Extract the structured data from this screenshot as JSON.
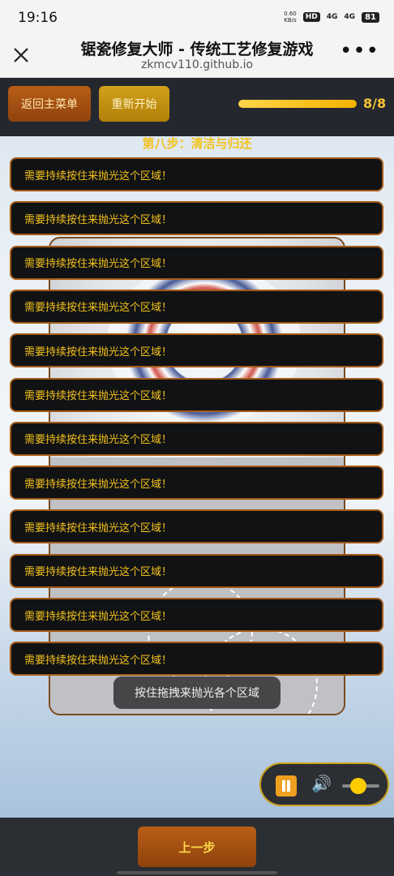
{
  "status_bar": {
    "time": "19:16",
    "speed": "0.60\nKB/s",
    "hd": "HD",
    "signal1": "4G",
    "signal2": "4G",
    "battery": "81"
  },
  "browser": {
    "title": "锯瓷修复大师 - 传统工艺修复游戏",
    "url": "zkmcv110.github.io",
    "close_icon": "close-icon",
    "more_icon": "more-icon"
  },
  "game": {
    "menu_button": "返回主菜单",
    "restart_button": "重新开始",
    "progress": {
      "current": 8,
      "total": 8,
      "label": "8/8",
      "fraction": 1.0
    },
    "step_title": "第八步：清洁与归还",
    "toasts": [
      "需要持续按住来抛光这个区域！",
      "需要持续按住来抛光这个区域！",
      "需要持续按住来抛光这个区域！",
      "需要持续按住来抛光这个区域！",
      "需要持续按住来抛光这个区域！",
      "需要持续按住来抛光这个区域！",
      "需要持续按住来抛光这个区域！",
      "需要持续按住来抛光这个区域！",
      "需要持续按住来抛光这个区域！",
      "需要持续按住来抛光这个区域！",
      "需要持续按住来抛光这个区域！",
      "需要持续按住来抛光这个区域！"
    ],
    "hint": "按住拖拽来抛光各个区域",
    "audio": {
      "pause_icon": "pause-icon",
      "speaker_icon": "speaker-icon",
      "volume": 0.3
    },
    "prev_button": "上一步"
  },
  "colors": {
    "accent": "#f2c21b",
    "brown": "#a35a17",
    "dark": "#24272d"
  }
}
